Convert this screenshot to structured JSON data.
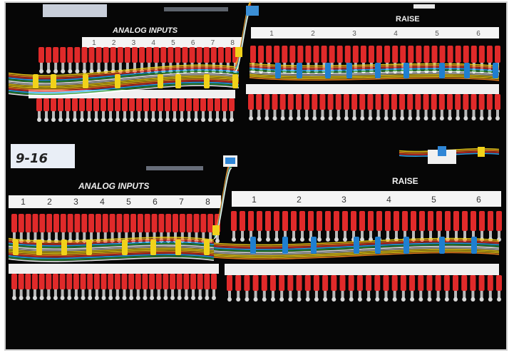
{
  "panels": [
    {
      "analog_label": "ANALOG INPUTS",
      "raise_label": "RAISE",
      "analog_channels": [
        "1",
        "2",
        "3",
        "4",
        "5",
        "6",
        "7",
        "8"
      ],
      "raise_channels": [
        "1",
        "2",
        "3",
        "4",
        "5",
        "6"
      ]
    },
    {
      "analog_label": "ANALOG INPUTS",
      "raise_label": "RAISE",
      "tape_label": "9-16",
      "analog_channels": [
        "1",
        "2",
        "3",
        "4",
        "5",
        "6",
        "7",
        "8"
      ],
      "raise_channels": [
        "1",
        "2",
        "3",
        "4",
        "5",
        "6"
      ]
    }
  ],
  "colors": {
    "terminal_red": "#e02a2a",
    "wire_yellow": "#f1d21a",
    "tie_blue": "#1f7fd0",
    "panel_black": "#070707",
    "strip_white": "#f4f4f4"
  }
}
